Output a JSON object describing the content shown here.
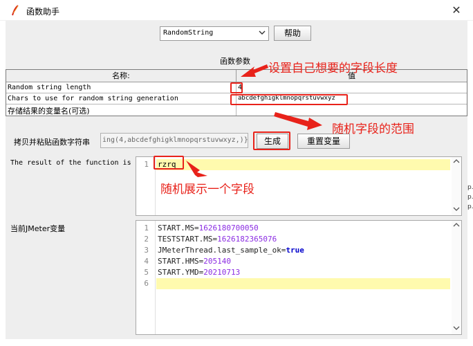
{
  "window": {
    "title": "函数助手",
    "close_glyph": "✕"
  },
  "toolbar": {
    "function_select": "RandomString",
    "help_label": "帮助"
  },
  "params": {
    "section_label": "函数参数",
    "col_name": "名称:",
    "col_value": "值",
    "rows": [
      {
        "name": "Random string length",
        "value": "4"
      },
      {
        "name": "Chars to use for random string generation",
        "value": "abcdefghigklmnopqrstuvwxyz"
      },
      {
        "name": "存储结果的变量名(可选)",
        "value": ""
      }
    ]
  },
  "generate": {
    "label": "拷贝并粘贴函数字符串",
    "function_string": "ing(4,abcdefghigklmnopqrstuvwxyz,)}",
    "generate_label": "生成",
    "reset_label": "重置变量"
  },
  "result": {
    "label": "The result of the function is",
    "lines": [
      {
        "no": "1",
        "text": "rzrq"
      }
    ]
  },
  "vars": {
    "label": "当前JMeter变量",
    "lines": [
      {
        "no": "1",
        "key": "START.MS=",
        "val": "1626180700050"
      },
      {
        "no": "2",
        "key": "TESTSTART.MS=",
        "val": "1626182365076"
      },
      {
        "no": "3",
        "key": "JMeterThread.last_sample_ok=",
        "val": "true"
      },
      {
        "no": "4",
        "key": "START.HMS=",
        "val": "205140"
      },
      {
        "no": "5",
        "key": "START.YMD=",
        "val": "20210713"
      },
      {
        "no": "6",
        "key": "",
        "val": ""
      }
    ]
  },
  "annotations": {
    "length": "设置自己想要的字段长度",
    "range": "随机字段的范围",
    "result": "随机展示一个字段"
  },
  "colors": {
    "annotation_red": "#e8221a",
    "highlight_yellow": "#fffaae"
  },
  "side_clip": [
    "p.",
    "p.",
    "p."
  ]
}
